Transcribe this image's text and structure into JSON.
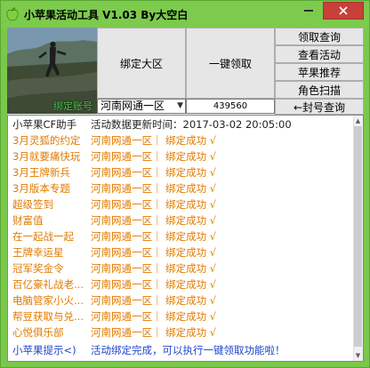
{
  "window": {
    "title": "小苹果活动工具 V1.03   By大空白",
    "minimize_glyph": "—",
    "close_glyph": "✕"
  },
  "photo": {
    "label": "绑定账号"
  },
  "buttons": {
    "bind_region": "绑定大区",
    "one_click_claim": "一键领取",
    "claim_query": "领取查询",
    "view_activity": "查看活动",
    "recommend": "苹果推荐",
    "role_scan": "角色扫描",
    "ban_query": "←封号查询"
  },
  "region_select": {
    "value": "河南网通一区",
    "options_visible": [
      "河南网通一区"
    ]
  },
  "qq_field": {
    "value": "439560"
  },
  "list": {
    "header": {
      "col1": "小苹果CF助手",
      "col2": "活动数据更新时间：2017-03-02 20:05:00"
    },
    "rows": [
      {
        "col1": "3月灵狐的约定",
        "col2": "河南网通一区｜ 绑定成功 √"
      },
      {
        "col1": "3月就要痛快玩",
        "col2": "河南网通一区｜ 绑定成功 √"
      },
      {
        "col1": "3月王牌新兵",
        "col2": "河南网通一区｜ 绑定成功 √"
      },
      {
        "col1": "3月版本专题",
        "col2": "河南网通一区｜ 绑定成功 √"
      },
      {
        "col1": "超级签到",
        "col2": "河南网通一区｜ 绑定成功 √"
      },
      {
        "col1": "财富值",
        "col2": "河南网通一区｜ 绑定成功 √"
      },
      {
        "col1": "在一起战一起",
        "col2": "河南网通一区｜ 绑定成功 √"
      },
      {
        "col1": "王牌幸运星",
        "col2": "河南网通一区｜ 绑定成功 √"
      },
      {
        "col1": "冠军奖金令",
        "col2": "河南网通一区｜ 绑定成功 √"
      },
      {
        "col1": "百亿豪礼战老...",
        "col2": "河南网通一区｜ 绑定成功 √"
      },
      {
        "col1": "电脑管家小火...",
        "col2": "河南网通一区｜ 绑定成功 √"
      },
      {
        "col1": "帮豆获取与兑...",
        "col2": "河南网通一区｜ 绑定成功 √"
      },
      {
        "col1": "心悦俱乐部",
        "col2": "河南网通一区｜ 绑定成功 √"
      }
    ],
    "footer": {
      "col1": "小苹果提示<)",
      "col2": "活动绑定完成，可以执行一键领取功能啦！"
    }
  },
  "colors": {
    "title_bar": "#7ccb4c",
    "activity_text": "#e07a00",
    "status_text": "#2244c8",
    "close_button": "#c7403a"
  }
}
